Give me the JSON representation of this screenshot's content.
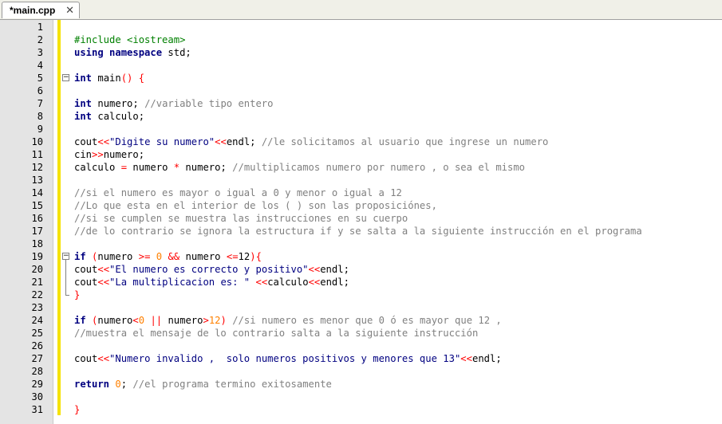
{
  "tab": {
    "title": "*main.cpp",
    "close": "✕"
  },
  "lines": [
    {
      "n": "1",
      "t": []
    },
    {
      "n": "2",
      "t": [
        [
          "pp",
          "#include <iostream>"
        ]
      ]
    },
    {
      "n": "3",
      "t": [
        [
          "kw",
          "using"
        ],
        [
          "",
          " "
        ],
        [
          "kw",
          "namespace"
        ],
        [
          "",
          " std;"
        ]
      ]
    },
    {
      "n": "4",
      "t": []
    },
    {
      "n": "5",
      "fold": "start",
      "t": [
        [
          "kw",
          "int"
        ],
        [
          "",
          " main"
        ],
        [
          "br",
          "()"
        ],
        [
          "",
          " "
        ],
        [
          "br",
          "{"
        ]
      ]
    },
    {
      "n": "6",
      "t": []
    },
    {
      "n": "7",
      "t": [
        [
          "kw",
          "int"
        ],
        [
          "",
          " numero; "
        ],
        [
          "cm",
          "//variable tipo entero"
        ]
      ]
    },
    {
      "n": "8",
      "t": [
        [
          "kw",
          "int"
        ],
        [
          "",
          " calculo;"
        ]
      ]
    },
    {
      "n": "9",
      "t": []
    },
    {
      "n": "10",
      "t": [
        [
          "",
          "cout"
        ],
        [
          "op",
          "<<"
        ],
        [
          "st",
          "\"Digite su numero\""
        ],
        [
          "op",
          "<<"
        ],
        [
          "",
          "endl; "
        ],
        [
          "cm",
          "//le solicitamos al usuario que ingrese un numero"
        ]
      ]
    },
    {
      "n": "11",
      "t": [
        [
          "",
          "cin"
        ],
        [
          "op",
          ">>"
        ],
        [
          "",
          "numero;"
        ]
      ]
    },
    {
      "n": "12",
      "t": [
        [
          "",
          "calculo "
        ],
        [
          "op",
          "="
        ],
        [
          "",
          " numero "
        ],
        [
          "op",
          "*"
        ],
        [
          "",
          " numero; "
        ],
        [
          "cm",
          "//multiplicamos numero por numero , o sea el mismo"
        ]
      ]
    },
    {
      "n": "13",
      "t": []
    },
    {
      "n": "14",
      "t": [
        [
          "cm",
          "//si el numero es mayor o igual a 0 y menor o igual a 12"
        ]
      ]
    },
    {
      "n": "15",
      "t": [
        [
          "cm",
          "//Lo que esta en el interior de los ( ) son las proposiciónes,"
        ]
      ]
    },
    {
      "n": "16",
      "t": [
        [
          "cm",
          "//si se cumplen se muestra las instrucciones en su cuerpo"
        ]
      ]
    },
    {
      "n": "17",
      "t": [
        [
          "cm",
          "//de lo contrario se ignora la estructura if y se salta a la siguiente instrucción en el programa"
        ]
      ]
    },
    {
      "n": "18",
      "t": []
    },
    {
      "n": "19",
      "fold": "start",
      "t": [
        [
          "kw",
          "if"
        ],
        [
          "",
          " "
        ],
        [
          "br",
          "("
        ],
        [
          "",
          "numero "
        ],
        [
          "op",
          ">="
        ],
        [
          "",
          " "
        ],
        [
          "nm",
          "0"
        ],
        [
          "",
          " "
        ],
        [
          "op",
          "&&"
        ],
        [
          "",
          " numero "
        ],
        [
          "op",
          "<="
        ],
        [
          "",
          "12"
        ],
        [
          "br",
          ")"
        ],
        [
          "br",
          "{"
        ]
      ]
    },
    {
      "n": "20",
      "t": [
        [
          "",
          "cout"
        ],
        [
          "op",
          "<<"
        ],
        [
          "st",
          "\"El numero es correcto y positivo\""
        ],
        [
          "op",
          "<<"
        ],
        [
          "",
          "endl;"
        ]
      ]
    },
    {
      "n": "21",
      "t": [
        [
          "",
          "cout"
        ],
        [
          "op",
          "<<"
        ],
        [
          "st",
          "\"La multiplicacion es: \""
        ],
        [
          "",
          " "
        ],
        [
          "op",
          "<<"
        ],
        [
          "",
          "calculo"
        ],
        [
          "op",
          "<<"
        ],
        [
          "",
          "endl;"
        ]
      ]
    },
    {
      "n": "22",
      "fold": "end",
      "t": [
        [
          "br",
          "}"
        ]
      ]
    },
    {
      "n": "23",
      "t": []
    },
    {
      "n": "24",
      "t": [
        [
          "kw",
          "if"
        ],
        [
          "",
          " "
        ],
        [
          "br",
          "("
        ],
        [
          "",
          "numero"
        ],
        [
          "op",
          "<"
        ],
        [
          "nm",
          "0"
        ],
        [
          "",
          " "
        ],
        [
          "op",
          "||"
        ],
        [
          "",
          " numero"
        ],
        [
          "op",
          ">"
        ],
        [
          "nm",
          "12"
        ],
        [
          "br",
          ")"
        ],
        [
          "",
          " "
        ],
        [
          "cm",
          "//si numero es menor que 0 ó es mayor que 12 ,"
        ]
      ]
    },
    {
      "n": "25",
      "t": [
        [
          "cm",
          "//muestra el mensaje de lo contrario salta a la siguiente instrucción"
        ]
      ]
    },
    {
      "n": "26",
      "t": []
    },
    {
      "n": "27",
      "t": [
        [
          "",
          "cout"
        ],
        [
          "op",
          "<<"
        ],
        [
          "st",
          "\"Numero invalido ,  solo numeros positivos y menores que 13\""
        ],
        [
          "op",
          "<<"
        ],
        [
          "",
          "endl;"
        ]
      ]
    },
    {
      "n": "28",
      "t": []
    },
    {
      "n": "29",
      "t": [
        [
          "kw",
          "return"
        ],
        [
          "",
          " "
        ],
        [
          "nm",
          "0"
        ],
        [
          "",
          "; "
        ],
        [
          "cm",
          "//el programa termino exitosamente"
        ]
      ]
    },
    {
      "n": "30",
      "t": []
    },
    {
      "n": "31",
      "fold": "end",
      "t": [
        [
          "br",
          "}"
        ]
      ]
    }
  ]
}
